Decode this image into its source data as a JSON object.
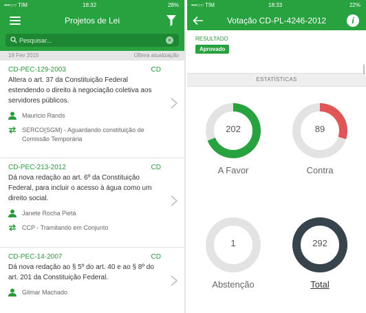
{
  "left": {
    "status": {
      "carrier": "•••○○ TIM",
      "time": "18:32",
      "battery": "28%"
    },
    "title": "Projetos de Lei",
    "search_placeholder": "Pesquisar...",
    "date": "19 Fev 2015",
    "updated_label": "Última atualização",
    "items": [
      {
        "code": "CD-PEC-129-2003",
        "house": "CD",
        "text": "Altera o art. 37 da Constituição Federal estendendo o direito à negociação coletiva aos servidores públicos.",
        "author": "Mauricio Rands",
        "status": "SERCO(SGM) - Aguardando constituição de Comissão Temporária"
      },
      {
        "code": "CD-PEC-213-2012",
        "house": "CD",
        "text": "Dá nova redação ao art. 6º da Constituição Federal, para incluir o acesso à água como um direito social.",
        "author": "Janete Rocha Pietá",
        "status": "CCP - Tramitando em Conjunto"
      },
      {
        "code": "CD-PEC-14-2007",
        "house": "CD",
        "text": "Dá nova redação ao § 5º do art. 40 e ao § 8º do art. 201 da Constituição Federal.",
        "author": "Gilmar Machado"
      }
    ]
  },
  "right": {
    "status": {
      "carrier": "•••○○ TIM",
      "time": "18:33",
      "battery": "22%"
    },
    "title": "Votação CD-PL-4246-2012",
    "resultado_label": "RESULTADO",
    "resultado_value": "Aprovado",
    "stats_header": "ESTATÍSTICAS",
    "stats": [
      {
        "label": "A Favor",
        "value": "202",
        "fraction": 0.69,
        "color": "#27a23f"
      },
      {
        "label": "Contra",
        "value": "89",
        "fraction": 0.3,
        "color": "#e05555"
      },
      {
        "label": "Abstenção",
        "value": "1",
        "fraction": 0.0,
        "color": "#27a23f"
      },
      {
        "label": "Total",
        "value": "292",
        "fraction": 1.0,
        "color": "#37444c"
      }
    ]
  },
  "colors": {
    "primary": "#27a23f",
    "primary_dark": "#1d8733",
    "contra": "#e05555",
    "total": "#37444c",
    "track": "#e3e3e3"
  }
}
